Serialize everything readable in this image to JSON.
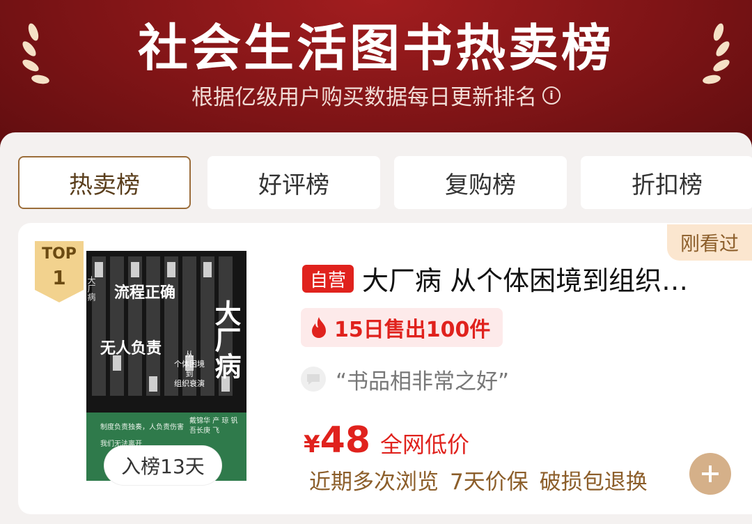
{
  "header": {
    "title": "社会生活图书热卖榜",
    "subtitle": "根据亿级用户购买数据每日更新排名",
    "info_icon": "info-icon"
  },
  "tabs": [
    {
      "label": "热卖榜",
      "active": true
    },
    {
      "label": "好评榜",
      "active": false
    },
    {
      "label": "复购榜",
      "active": false
    },
    {
      "label": "折扣榜",
      "active": false
    }
  ],
  "product": {
    "seen_badge": "刚看过",
    "rank_top": "TOP",
    "rank_num": "1",
    "days_on_list": "入榜13天",
    "self_tag": "自营",
    "title": "大厂病 从个体困境到组织…",
    "sales": "15日售出100件",
    "review": "“书品相非常之好”",
    "price_currency": "¥",
    "price_value": "48",
    "price_label": "全网低价",
    "perks": [
      "近期多次浏览",
      "7天价保",
      "破损包退换"
    ],
    "cover": {
      "title": "大厂病",
      "subtitle_lines": [
        "从",
        "个体困境",
        "到",
        "组织衰演"
      ],
      "slogan_1": "流程正确",
      "slogan_2": "无人负责",
      "side_text": "大厂病",
      "authors": "戴锦华 产 琼 钒 吾长庚 飞",
      "green_line_1": "制度负责独奏，人负责伤害",
      "green_line_2": "我们无法离开"
    }
  },
  "colors": {
    "header_red": "#7e1416",
    "accent_red": "#e0221d",
    "gold_brown": "#8c5e2a"
  }
}
